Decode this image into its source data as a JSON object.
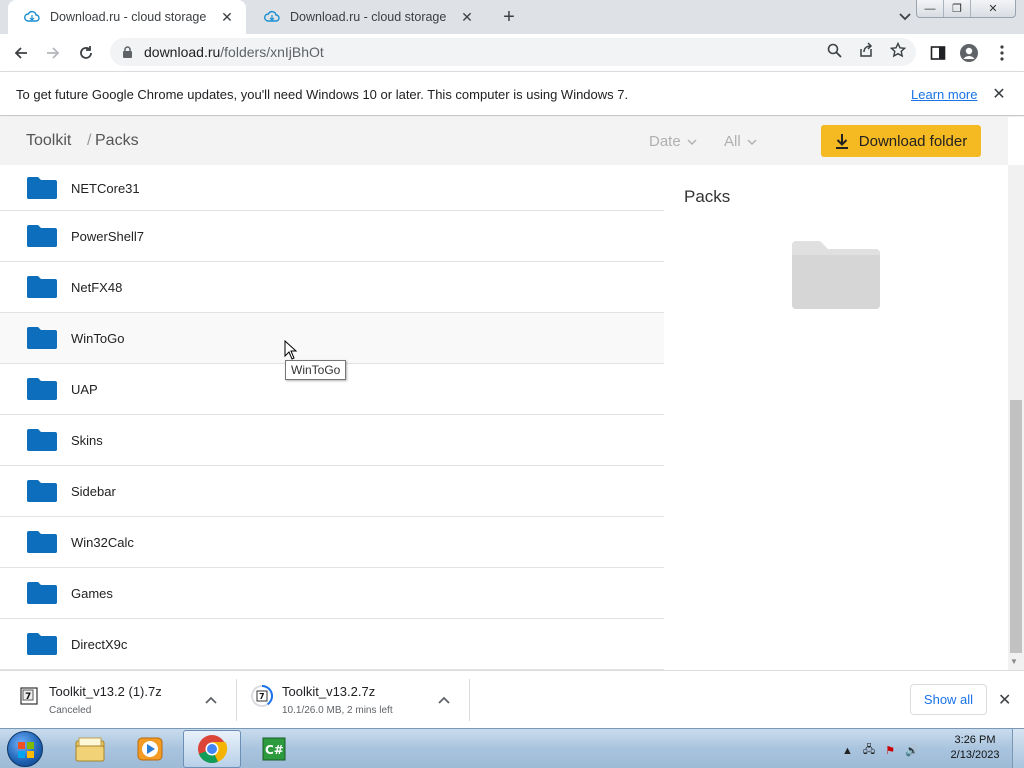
{
  "browser": {
    "tabs": [
      {
        "title": "Download.ru - cloud storage",
        "active": true
      },
      {
        "title": "Download.ru - cloud storage",
        "active": false
      }
    ],
    "url_host": "download.ru",
    "url_path": "/folders/xnIjBhOt"
  },
  "infobar": {
    "message": "To get future Google Chrome updates, you'll need Windows 10 or later. This computer is using Windows 7.",
    "learn_more": "Learn more"
  },
  "page": {
    "breadcrumb_root": "Toolkit",
    "breadcrumb_sep": "/",
    "breadcrumb_current": "Packs",
    "filter_date": "Date",
    "filter_all": "All",
    "download_folder": "Download folder",
    "folders": [
      "NETCore31",
      "PowerShell7",
      "NetFX48",
      "WinToGo",
      "UAP",
      "Skins",
      "Sidebar",
      "Win32Calc",
      "Games",
      "DirectX9c"
    ],
    "side_title": "Packs",
    "tooltip": "WinToGo",
    "folder_color": "#0d6ebc",
    "accent_color": "#f5b921"
  },
  "downloads": [
    {
      "name": "Toolkit_v13.2 (1).7z",
      "status": "Canceled"
    },
    {
      "name": "Toolkit_v13.2.7z",
      "status": "10.1/26.0 MB, 2 mins left"
    }
  ],
  "shelf": {
    "show_all": "Show all"
  },
  "taskbar": {
    "time": "3:26 PM",
    "date": "2/13/2023"
  }
}
